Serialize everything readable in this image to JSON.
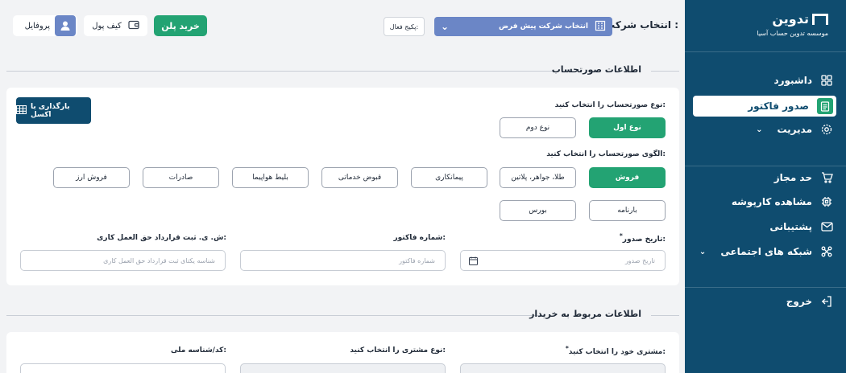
{
  "sidebar": {
    "logo_text": "تدوین",
    "logo_sub": "موسسه تدوین حساب آسیا",
    "items": [
      {
        "label": "داشبورد",
        "icon": "grid-icon"
      },
      {
        "label": "صدور فاکتور",
        "icon": "invoice-icon"
      },
      {
        "label": "مدیریت",
        "icon": "settings-icon"
      },
      {
        "label": "حد مجاز",
        "icon": "cart-icon"
      },
      {
        "label": "مشاهده کارپوشه",
        "icon": "cpu-icon"
      },
      {
        "label": "پشتیبانی",
        "icon": "mail-icon"
      },
      {
        "label": "شبکه های اجتماعی",
        "icon": "network-icon"
      },
      {
        "label": "خروج",
        "icon": "logout-icon"
      }
    ],
    "chevron": "⌄"
  },
  "topbar": {
    "company_label": "انتخاب شرکت :",
    "company_value": "انتخاب شرکت پیش فرض",
    "package_label": "پکیج فعال:",
    "buy_label": "خرید پلن",
    "wallet_label": "کیف پول",
    "profile_label": "پروفایل"
  },
  "invoice_section": {
    "title": "اطلاعات صورتحساب",
    "excel_button": "بارگذاری با اکسل",
    "type_label": "نوع صورتحساب را انتخاب کنید:",
    "types": [
      "نوع اول",
      "نوع دوم"
    ],
    "pattern_label": "الگوی صورتحساب را انتخاب کنید:",
    "patterns_row1": [
      "فروش",
      "طلا، جواهر، پلاتین",
      "پیمانکاری",
      "قبوض خدماتی",
      "بلیط هواپیما",
      "صادرات",
      "فروش ارز"
    ],
    "patterns_row2": [
      "بارنامه",
      "بورس"
    ],
    "issue_date_label": "تاریخ صدور:",
    "issue_date_placeholder": "تاریخ صدور",
    "invoice_no_label": "شماره فاکتور:",
    "invoice_no_placeholder": "شماره فاکتور",
    "contract_label": "ش. ی. ثبت قرارداد حق العمل کاری:",
    "contract_placeholder": "شناسه یکتای ثبت قرارداد حق العمل کاری",
    "required_mark": "*"
  },
  "buyer_section": {
    "title": "اطلاعات مربوط به خریدار",
    "customer_label": "مشتری خود را انتخاب کنید:",
    "customer_type_label": "نوع مشتری را انتخاب کنید:",
    "national_id_label": "کد/شناسه ملی:",
    "required_mark": "*"
  },
  "colors": {
    "sidebar": "#0f4c6f",
    "accent_green": "#23a373",
    "company_select": "#6b86c6"
  }
}
